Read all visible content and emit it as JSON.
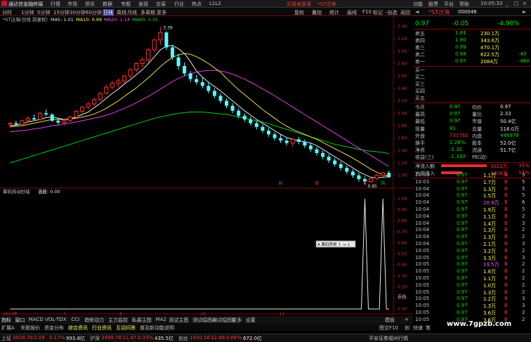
{
  "menubar": {
    "app_title": "通达信金融终端",
    "items": [
      "行情",
      "市场",
      "资讯",
      "数据",
      "专题",
      "发现",
      "交易",
      "行业",
      "热点",
      "L1L2"
    ],
    "trade_login": "交易未登录",
    "stock_title": "*ST泛海",
    "right_items": [
      "功能",
      "股票",
      "平台",
      "帮助"
    ],
    "clock": "10:05:33"
  },
  "toolbar": {
    "periods": [
      "分时",
      "1分钟",
      "5分钟",
      "15分钟",
      "30分钟",
      "60分钟",
      "日线",
      "周线",
      "月线",
      "多周期",
      "更多"
    ],
    "active_period": "日线",
    "right_buttons": [
      "复权",
      "叠加",
      "统计",
      "画线",
      "F10",
      "标记",
      "-自选",
      "返回"
    ]
  },
  "chart_header": {
    "name_line": "*ST泛海(日线 前复权)",
    "ma5": "MA5: 1.01",
    "ma10": "MA10: 0.99",
    "ma20": "MA20: 1.14",
    "ma60": "MA60: 1.35"
  },
  "sub_header": {
    "name": "筹码异动抄底",
    "value": "选股: 0.00"
  },
  "price_axis": [
    "3.40",
    "3.20",
    "3.00",
    "2.80",
    "2.60",
    "2.40",
    "2.20",
    "2.00",
    "1.80",
    "1.60",
    "1.40",
    "1.20",
    "1.00"
  ],
  "sub_axis": [
    "1.00",
    "0.90",
    "0.80",
    "0.70",
    "0.60",
    "0.50",
    "0.40",
    "0.30",
    "0.20",
    "0.10",
    "0.00"
  ],
  "sub_unit": "百线",
  "date_axis": [
    "2023年",
    "7",
    "8",
    "10",
    "11"
  ],
  "high_label": "3.39",
  "low_label": "0.85",
  "chart_data": {
    "type": "candlestick",
    "title": "*ST泛海(日线 前复权)",
    "ylim": [
      0.85,
      3.45
    ],
    "ohlc": [
      [
        1.82,
        1.86,
        1.78,
        1.84
      ],
      [
        1.84,
        1.88,
        1.8,
        1.82
      ],
      [
        1.82,
        1.9,
        1.81,
        1.88
      ],
      [
        1.88,
        1.95,
        1.86,
        1.92
      ],
      [
        1.92,
        1.98,
        1.89,
        1.9
      ],
      [
        1.9,
        2.02,
        1.88,
        2.0
      ],
      [
        2.0,
        2.06,
        1.96,
        1.98
      ],
      [
        1.98,
        2.0,
        1.86,
        1.88
      ],
      [
        1.88,
        1.92,
        1.82,
        1.85
      ],
      [
        1.85,
        1.9,
        1.8,
        1.88
      ],
      [
        1.88,
        1.96,
        1.86,
        1.94
      ],
      [
        1.94,
        2.05,
        1.92,
        2.03
      ],
      [
        2.03,
        2.12,
        2.0,
        2.1
      ],
      [
        2.1,
        2.18,
        2.06,
        2.15
      ],
      [
        2.15,
        2.25,
        2.12,
        2.22
      ],
      [
        2.22,
        2.34,
        2.2,
        2.32
      ],
      [
        2.32,
        2.45,
        2.3,
        2.42
      ],
      [
        2.42,
        2.52,
        2.38,
        2.48
      ],
      [
        2.48,
        2.56,
        2.42,
        2.52
      ],
      [
        2.52,
        2.62,
        2.48,
        2.6
      ],
      [
        2.6,
        2.72,
        2.56,
        2.7
      ],
      [
        2.7,
        2.82,
        2.66,
        2.8
      ],
      [
        2.8,
        2.9,
        2.74,
        2.86
      ],
      [
        2.86,
        3.05,
        2.82,
        3.02
      ],
      [
        3.02,
        3.2,
        2.98,
        3.18
      ],
      [
        3.18,
        3.39,
        3.1,
        3.3
      ],
      [
        3.3,
        3.32,
        3.02,
        3.06
      ],
      [
        3.06,
        3.1,
        2.86,
        2.9
      ],
      [
        2.9,
        2.96,
        2.7,
        2.76
      ],
      [
        2.76,
        2.82,
        2.6,
        2.64
      ],
      [
        2.64,
        2.68,
        2.5,
        2.55
      ],
      [
        2.55,
        2.62,
        2.46,
        2.5
      ],
      [
        2.5,
        2.58,
        2.4,
        2.44
      ],
      [
        2.44,
        2.5,
        2.32,
        2.36
      ],
      [
        2.36,
        2.4,
        2.24,
        2.28
      ],
      [
        2.28,
        2.32,
        2.16,
        2.2
      ],
      [
        2.2,
        2.24,
        2.08,
        2.12
      ],
      [
        2.12,
        2.16,
        2.0,
        2.04
      ],
      [
        2.04,
        2.08,
        1.92,
        1.96
      ],
      [
        1.96,
        2.0,
        1.86,
        1.9
      ],
      [
        1.9,
        1.95,
        1.8,
        1.84
      ],
      [
        1.84,
        1.88,
        1.74,
        1.78
      ],
      [
        1.78,
        1.82,
        1.68,
        1.72
      ],
      [
        1.72,
        1.76,
        1.62,
        1.66
      ],
      [
        1.66,
        1.7,
        1.56,
        1.6
      ],
      [
        1.6,
        1.66,
        1.52,
        1.56
      ],
      [
        1.56,
        1.62,
        1.48,
        1.52
      ],
      [
        1.52,
        1.6,
        1.46,
        1.58
      ],
      [
        1.58,
        1.62,
        1.5,
        1.54
      ],
      [
        1.54,
        1.58,
        1.44,
        1.48
      ],
      [
        1.48,
        1.52,
        1.38,
        1.42
      ],
      [
        1.42,
        1.46,
        1.32,
        1.36
      ],
      [
        1.36,
        1.4,
        1.26,
        1.3
      ],
      [
        1.3,
        1.34,
        1.2,
        1.24
      ],
      [
        1.24,
        1.28,
        1.14,
        1.18
      ],
      [
        1.18,
        1.22,
        1.08,
        1.12
      ],
      [
        1.12,
        1.16,
        1.02,
        1.06
      ],
      [
        1.06,
        1.1,
        0.96,
        1.0
      ],
      [
        1.0,
        1.04,
        0.9,
        0.94
      ],
      [
        0.94,
        0.98,
        0.85,
        0.9
      ],
      [
        0.9,
        0.96,
        0.88,
        0.95
      ],
      [
        0.95,
        1.02,
        0.93,
        1.0
      ],
      [
        1.0,
        1.06,
        0.97,
        1.04
      ],
      [
        1.04,
        1.08,
        0.96,
        0.97
      ]
    ],
    "ma5": [
      1.8,
      1.81,
      1.83,
      1.86,
      1.88,
      1.9,
      1.93,
      1.94,
      1.92,
      1.9,
      1.91,
      1.94,
      1.98,
      2.02,
      2.09,
      2.16,
      2.24,
      2.32,
      2.39,
      2.47,
      2.54,
      2.62,
      2.7,
      2.8,
      2.91,
      3.02,
      3.08,
      3.09,
      3.04,
      2.96,
      2.83,
      2.68,
      2.58,
      2.5,
      2.43,
      2.36,
      2.28,
      2.2,
      2.12,
      2.04,
      1.97,
      1.9,
      1.84,
      1.78,
      1.72,
      1.66,
      1.61,
      1.58,
      1.56,
      1.54,
      1.52,
      1.48,
      1.42,
      1.36,
      1.3,
      1.24,
      1.18,
      1.12,
      1.06,
      1.01,
      0.97,
      0.96,
      0.97,
      0.98
    ],
    "ma10": [
      1.78,
      1.79,
      1.8,
      1.82,
      1.84,
      1.86,
      1.88,
      1.9,
      1.9,
      1.9,
      1.91,
      1.92,
      1.94,
      1.96,
      1.99,
      2.03,
      2.08,
      2.14,
      2.2,
      2.27,
      2.34,
      2.41,
      2.49,
      2.57,
      2.66,
      2.75,
      2.83,
      2.9,
      2.94,
      2.96,
      2.95,
      2.91,
      2.86,
      2.8,
      2.73,
      2.66,
      2.56,
      2.47,
      2.38,
      2.3,
      2.22,
      2.14,
      2.06,
      1.99,
      1.92,
      1.85,
      1.79,
      1.74,
      1.7,
      1.66,
      1.62,
      1.58,
      1.53,
      1.48,
      1.43,
      1.38,
      1.33,
      1.28,
      1.22,
      1.16,
      1.1,
      1.05,
      1.01,
      0.99
    ],
    "ma20": [
      1.7,
      1.71,
      1.72,
      1.73,
      1.75,
      1.76,
      1.78,
      1.8,
      1.81,
      1.83,
      1.84,
      1.86,
      1.88,
      1.9,
      1.92,
      1.94,
      1.97,
      2.0,
      2.04,
      2.08,
      2.12,
      2.17,
      2.22,
      2.27,
      2.33,
      2.39,
      2.45,
      2.51,
      2.56,
      2.6,
      2.64,
      2.66,
      2.68,
      2.69,
      2.69,
      2.68,
      2.66,
      2.63,
      2.59,
      2.55,
      2.5,
      2.45,
      2.39,
      2.34,
      2.28,
      2.22,
      2.16,
      2.1,
      2.04,
      1.98,
      1.92,
      1.86,
      1.8,
      1.74,
      1.68,
      1.62,
      1.56,
      1.5,
      1.44,
      1.38,
      1.32,
      1.26,
      1.2,
      1.14
    ],
    "ma60": [
      1.2,
      1.23,
      1.26,
      1.29,
      1.32,
      1.35,
      1.38,
      1.41,
      1.44,
      1.47,
      1.5,
      1.53,
      1.56,
      1.59,
      1.62,
      1.65,
      1.68,
      1.71,
      1.74,
      1.77,
      1.8,
      1.83,
      1.86,
      1.89,
      1.92,
      1.94,
      1.96,
      1.98,
      2.0,
      2.01,
      2.02,
      2.02,
      2.02,
      2.01,
      2.0,
      1.99,
      1.98,
      1.96,
      1.94,
      1.92,
      1.9,
      1.88,
      1.86,
      1.83,
      1.8,
      1.77,
      1.74,
      1.71,
      1.68,
      1.65,
      1.62,
      1.59,
      1.56,
      1.53,
      1.5,
      1.48,
      1.46,
      1.44,
      1.42,
      1.4,
      1.39,
      1.38,
      1.37,
      1.35
    ],
    "signal": [
      0,
      0,
      0,
      0,
      0,
      0,
      0,
      0,
      0,
      0,
      0,
      0,
      0,
      0,
      0,
      0,
      0,
      0,
      0,
      0,
      0,
      0,
      0,
      0,
      0,
      0,
      0,
      0,
      0,
      0,
      0,
      0,
      0,
      0,
      0,
      0,
      0,
      0,
      0,
      0,
      0,
      0,
      0,
      0,
      0,
      0,
      0,
      0,
      0,
      0,
      0,
      0,
      0,
      0,
      0,
      0,
      0,
      0,
      0,
      1,
      0,
      0,
      1,
      0
    ]
  },
  "tooltip": "A 筹码异常  ↑ → ↓",
  "quote": {
    "title": "*ST泛海",
    "code": "000046",
    "price": "0.97",
    "change": "-0.05",
    "change_pct": "-4.90%",
    "asks": [
      {
        "label": "卖五",
        "price": "1.01",
        "vol": "230.1万",
        "chg": ""
      },
      {
        "label": "卖四",
        "price": "1.00",
        "vol": "343.6万",
        "chg": ""
      },
      {
        "label": "卖三",
        "price": "0.99",
        "vol": "470.1万",
        "chg": ""
      },
      {
        "label": "卖二",
        "price": "0.98",
        "vol": "622.5万",
        "chg": "-43"
      },
      {
        "label": "卖一",
        "price": "0.97",
        "vol": "2084万",
        "chg": "-460"
      }
    ],
    "bids": [
      "买一",
      "买二",
      "买三",
      "买四",
      "买五"
    ],
    "stats": [
      {
        "l1": "今开",
        "v1": "0.97",
        "l2": "均价",
        "v2": "0.97"
      },
      {
        "l1": "最高",
        "v1": "0.97",
        "l2": "量比",
        "v2": "2.33"
      },
      {
        "l1": "最低",
        "v1": "0.97",
        "l2": "市值",
        "v2": "50.4亿"
      },
      {
        "l1": "现量",
        "v1": "81",
        "l2": "总量",
        "v2": "118.0万"
      },
      {
        "l1": "外盘",
        "v1": "731762",
        "l2": "内盘",
        "v2": "448979"
      },
      {
        "l1": "换手",
        "v1": "2.28%",
        "l2": "股本",
        "v2": "52.0亿"
      },
      {
        "l1": "净资",
        "v1": "-2.32",
        "l2": "流通",
        "v2": "51.7亿"
      },
      {
        "l1": "收益(三)",
        "v1": "-1.330",
        "l2": "PE(动)",
        "v2": ""
      }
    ],
    "flow": [
      {
        "label": "净流入额",
        "value": "3022万",
        "pct": "33%"
      },
      {
        "label": "大宗流入",
        "value": "1408万",
        "pct": "12%"
      }
    ],
    "ticks": [
      {
        "t": "10:03",
        "p": "0.97",
        "v": "1.1万",
        "s": "B",
        "c": "3"
      },
      {
        "t": "10:03",
        "p": "0.97",
        "v": "1.7万",
        "s": "B",
        "c": "5"
      },
      {
        "t": "10:04",
        "p": "0.97",
        "v": "1.3万",
        "s": "B",
        "c": "5"
      },
      {
        "t": "10:04",
        "p": "0.97",
        "v": "1.5万",
        "s": "B",
        "c": "5"
      },
      {
        "t": "10:04",
        "p": "0.97",
        "v": "20.9万",
        "s": "B",
        "c": "6"
      },
      {
        "t": "10:04",
        "p": "0.97",
        "v": "1.9万",
        "s": "B",
        "c": "5"
      },
      {
        "t": "10:04",
        "p": "0.97",
        "v": "1.1万",
        "s": "B",
        "c": "2"
      },
      {
        "t": "10:04",
        "p": "0.97",
        "v": "1.4万",
        "s": "B",
        "c": "3"
      },
      {
        "t": "10:04",
        "p": "0.97",
        "v": "1.3万",
        "s": "B",
        "c": "2"
      },
      {
        "t": "10:04",
        "p": "0.97",
        "v": "1.3万",
        "s": "B",
        "c": "2"
      },
      {
        "t": "10:04",
        "p": "0.97",
        "v": "2.1万",
        "s": "B",
        "c": "3"
      },
      {
        "t": "10:05",
        "p": "0.97",
        "v": "3.2万",
        "s": "B",
        "c": "2"
      },
      {
        "t": "10:05",
        "p": "0.97",
        "v": "3.3万",
        "s": "B",
        "c": "3"
      },
      {
        "t": "10:05",
        "p": "0.97",
        "v": "19.5万",
        "s": "B",
        "c": "2"
      },
      {
        "t": "10:05",
        "p": "0.97",
        "v": "1.8万",
        "s": "B",
        "c": "2"
      },
      {
        "t": "10:05",
        "p": "0.97",
        "v": "1.1万",
        "s": "B",
        "c": "2"
      },
      {
        "t": "10:05",
        "p": "0.97",
        "v": "1.0万",
        "s": "B",
        "c": "2"
      },
      {
        "t": "10:05",
        "p": "0.97",
        "v": "1.3万",
        "s": "B",
        "c": "2"
      },
      {
        "t": "10:05",
        "p": "0.97",
        "v": "1.2万",
        "s": "B",
        "c": "3"
      },
      {
        "t": "10:05",
        "p": "0.97",
        "v": "1.3万",
        "s": "B",
        "c": "3"
      },
      {
        "t": "10:05",
        "p": "0.97",
        "v": "3.6万",
        "s": "B",
        "c": "2"
      },
      {
        "t": "10:05",
        "p": "0.97",
        "v": "3.6万",
        "s": "B",
        "c": "2"
      }
    ]
  },
  "bottom_tabs": [
    "指标",
    "窗口",
    "MACD",
    "VOL-TDX",
    "CCI",
    "趋势动力",
    "主力监控",
    "私募主图",
    "MA2",
    "测试主图",
    "测试幅图A",
    "测试幅图B",
    "更多",
    "设置"
  ],
  "bottom_tabs_right": [
    "模板",
    "+"
  ],
  "bottom_tabs2": [
    "扩展A",
    "关联报价",
    "资金分布",
    "综合资讯",
    "行业资讯",
    "互动问答",
    "普及新动能说明"
  ],
  "bottom_tabs2_right": [
    "图文F10",
    "创",
    "快速",
    "笔"
  ],
  "statusbar": {
    "items": [
      {
        "name": "上证",
        "value": "3026.78",
        "chg": "5.09",
        "pct": "0.17%",
        "amt": "993.8亿"
      },
      {
        "name": "沪深",
        "value": "3499.78",
        "chg": "11.47",
        "pct": "0.33%",
        "amt": "435.5亿"
      },
      {
        "name": "创业",
        "value": "1930.56",
        "chg": "12.66",
        "pct": "0.66%",
        "amt": "672.0亿"
      }
    ],
    "broker": "平安证券福州行情",
    "watermark": "www.7gpzb.com"
  }
}
